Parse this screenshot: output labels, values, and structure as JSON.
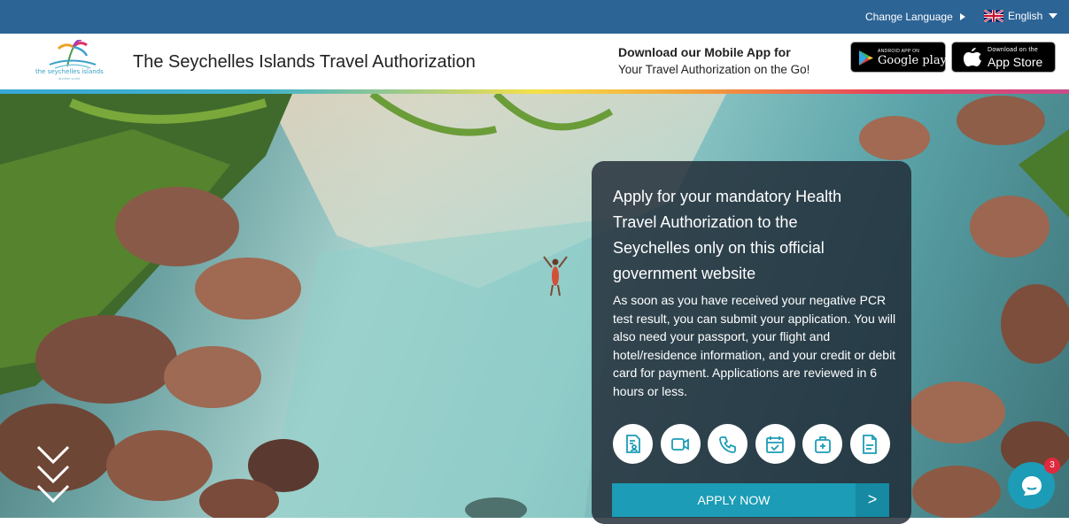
{
  "topbar": {
    "change_language": "Change Language",
    "language": "English"
  },
  "header": {
    "logo_text": "the seychelles islands",
    "logo_subtext": "another world",
    "title": "The Seychelles Islands Travel Authorization",
    "promo_title": "Download our Mobile App for",
    "promo_subtitle": "Your Travel Authorization on the Go!",
    "google_play_small": "ANDROID APP ON",
    "google_play_big": "Google play",
    "app_store_small": "Download on the",
    "app_store_big": "App Store"
  },
  "card": {
    "title": "Apply for your mandatory Health Travel Authorization to the Seychelles only on this official government website",
    "body": "As soon as you have received your negative PCR test result, you can submit your application. You will also need your passport, your flight and hotel/residence information, and your credit or debit card for payment. Applications are reviewed in 6 hours or less.",
    "icons": [
      "document-person-icon",
      "video-camera-icon",
      "phone-icon",
      "calendar-check-icon",
      "medical-kit-icon",
      "document-icon"
    ],
    "apply_label": "APPLY NOW",
    "apply_arrow": ">"
  },
  "chat": {
    "badge_count": "3"
  },
  "colors": {
    "topbar": "#2d6496",
    "accent": "#1c9cb6",
    "card_bg": "#1e2834",
    "badge": "#e0293e"
  }
}
